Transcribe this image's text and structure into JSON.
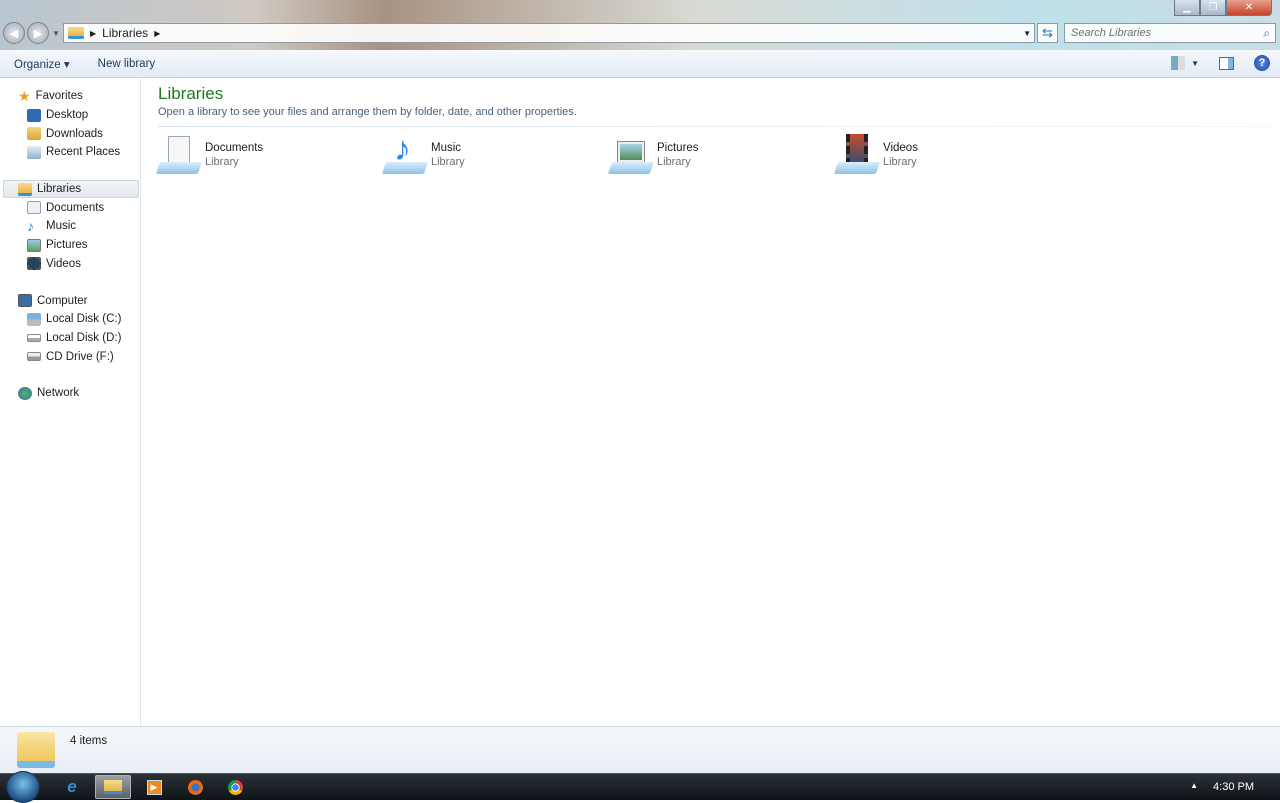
{
  "window": {
    "title_controls": [
      "minimize",
      "maximize",
      "close"
    ]
  },
  "address": {
    "crumbs": [
      "Libraries"
    ],
    "search_placeholder": "Search Libraries"
  },
  "toolbar": {
    "organize": "Organize ▾",
    "new_library": "New library"
  },
  "sidebar": {
    "favorites": {
      "label": "Favorites",
      "items": [
        "Desktop",
        "Downloads",
        "Recent Places"
      ]
    },
    "libraries": {
      "label": "Libraries",
      "items": [
        "Documents",
        "Music",
        "Pictures",
        "Videos"
      ]
    },
    "computer": {
      "label": "Computer",
      "items": [
        "Local Disk (C:)",
        "Local Disk (D:)",
        "CD Drive (F:)"
      ]
    },
    "network": {
      "label": "Network"
    }
  },
  "main": {
    "title": "Libraries",
    "subtitle": "Open a library to see your files and arrange them by folder, date, and other properties.",
    "libraries": [
      {
        "name": "Documents",
        "type": "Library"
      },
      {
        "name": "Music",
        "type": "Library"
      },
      {
        "name": "Pictures",
        "type": "Library"
      },
      {
        "name": "Videos",
        "type": "Library"
      }
    ]
  },
  "status": {
    "count": "4 items"
  },
  "taskbar": {
    "clock": "4:30 PM",
    "apps": [
      "Internet Explorer",
      "Windows Explorer",
      "Media Player",
      "Firefox",
      "Chrome"
    ]
  }
}
